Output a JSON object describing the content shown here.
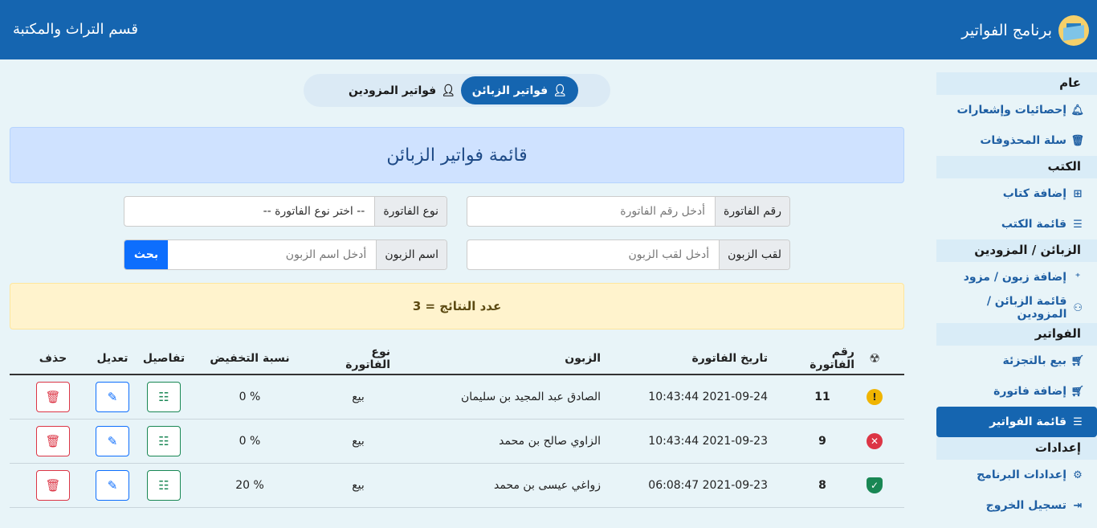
{
  "header": {
    "app_title": "برنامج الفواتير",
    "department": "قسم التراث والمكتبة"
  },
  "sidebar": {
    "sections": [
      {
        "title": "عام",
        "items": [
          {
            "label": "إحصائيات وإشعارات",
            "icon": "bell-icon",
            "glyph": "🔔︎"
          },
          {
            "label": "سلة المحذوفات",
            "icon": "trash-icon",
            "glyph": "🗑︎"
          }
        ]
      },
      {
        "title": "الكتب",
        "items": [
          {
            "label": "إضافة كتاب",
            "icon": "folder-plus-icon",
            "glyph": "⊞"
          },
          {
            "label": "قائمة الكتب",
            "icon": "list-icon",
            "glyph": "☰"
          }
        ]
      },
      {
        "title": "الزبائن / المزودين",
        "items": [
          {
            "label": "إضافة زبون / مزود",
            "icon": "person-plus-icon",
            "glyph": "⁺"
          },
          {
            "label": "قائمة الزبائن / المزودين",
            "icon": "people-icon",
            "glyph": "⚇"
          }
        ]
      },
      {
        "title": "الفواتير",
        "items": [
          {
            "label": "بيع بالتجزئة",
            "icon": "cart-icon",
            "glyph": "🛒︎"
          },
          {
            "label": "إضافة فاتورة",
            "icon": "cart-plus-icon",
            "glyph": "🛒︎"
          },
          {
            "label": "قائمة الفواتير",
            "icon": "list-icon",
            "glyph": "☰",
            "active": true
          }
        ]
      },
      {
        "title": "إعدادات",
        "items": [
          {
            "label": "إعدادات البرنامج",
            "icon": "gear-icon",
            "glyph": "⚙"
          },
          {
            "label": "تسجيل الخروج",
            "icon": "logout-icon",
            "glyph": "⇥"
          }
        ]
      }
    ]
  },
  "tabs": {
    "customers": "فواتير الزبائن",
    "suppliers": "فواتير المزودين"
  },
  "panel": {
    "title": "قائمة فواتير الزبائن"
  },
  "filters": {
    "invoice_number": {
      "label": "رقم الفاتورة",
      "placeholder": "أدخل رقم الفاتورة"
    },
    "invoice_type": {
      "label": "نوع الفاتورة",
      "value": "-- اختر نوع الفاتورة --"
    },
    "client_surname": {
      "label": "لقب الزبون",
      "placeholder": "أدخل لقب الزبون"
    },
    "client_name": {
      "label": "اسم الزبون",
      "placeholder": "أدخل اسم الزبون"
    },
    "search_button": "بحث"
  },
  "results": {
    "text": "عدد النتائج = 3"
  },
  "table": {
    "headers": {
      "number": "رقم الفاتورة",
      "date": "تاريخ الفاتورة",
      "client": "الزبون",
      "type": "نوع الفاتورة",
      "discount": "نسبة التخفيض",
      "details": "تفاصيل",
      "edit": "تعديل",
      "delete": "حذف"
    },
    "rows": [
      {
        "status": "warning",
        "number": "11",
        "date": "2021-09-24 10:43:44",
        "client": "الصادق عبد المجيد بن سليمان",
        "type": "بيع",
        "discount": "% 0"
      },
      {
        "status": "error",
        "number": "9",
        "date": "2021-09-23 10:43:44",
        "client": "الزاوي صالح بن محمد",
        "type": "بيع",
        "discount": "% 0"
      },
      {
        "status": "ok",
        "number": "8",
        "date": "2021-09-23 06:08:47",
        "client": "زواغي عيسى بن محمد",
        "type": "بيع",
        "discount": "% 20"
      }
    ]
  },
  "colors": {
    "primary": "#1565b0",
    "info_bg": "#cfe2ff",
    "warning_bg": "#fff3cd"
  }
}
